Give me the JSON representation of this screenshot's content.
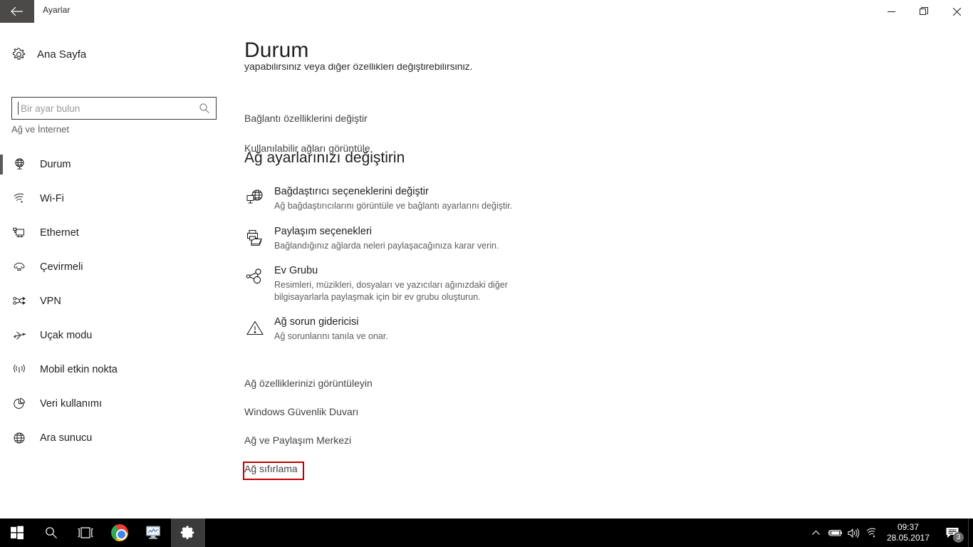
{
  "window": {
    "title": "Ayarlar",
    "back_icon": "back-arrow-icon",
    "minimize_label": "—",
    "restore_label": "❐",
    "close_label": "✕"
  },
  "sidebar": {
    "home": {
      "label": "Ana Sayfa",
      "icon": "gear-icon"
    },
    "search": {
      "value": "",
      "placeholder": "Bir ayar bulun",
      "icon": "search-icon"
    },
    "category": "Ağ ve İnternet",
    "items": [
      {
        "label": "Durum",
        "icon": "globe-status-icon",
        "selected": true
      },
      {
        "label": "Wi-Fi",
        "icon": "wifi-icon",
        "selected": false
      },
      {
        "label": "Ethernet",
        "icon": "ethernet-icon",
        "selected": false
      },
      {
        "label": "Çevirmeli",
        "icon": "dialup-icon",
        "selected": false
      },
      {
        "label": "VPN",
        "icon": "vpn-icon",
        "selected": false
      },
      {
        "label": "Uçak modu",
        "icon": "airplane-icon",
        "selected": false
      },
      {
        "label": "Mobil etkin nokta",
        "icon": "hotspot-icon",
        "selected": false
      },
      {
        "label": "Veri kullanımı",
        "icon": "pie-chart-icon",
        "selected": false
      },
      {
        "label": "Ara sunucu",
        "icon": "proxy-globe-icon",
        "selected": false
      }
    ]
  },
  "content": {
    "page_title": "Durum",
    "clipped_text": "yapabilirsiniz veya diğer özellikleri değiştirebilirsiniz.",
    "top_links": [
      "Bağlantı özelliklerini değiştir",
      "Kullanılabilir ağları görüntüle"
    ],
    "section_header": "Ağ ayarlarınızı değiştirin",
    "actions": [
      {
        "icon": "network-adapter-icon",
        "title": "Bağdaştırıcı seçeneklerini değiştir",
        "desc": "Ağ bağdaştırıcılarını görüntüle ve bağlantı ayarlarını değiştir."
      },
      {
        "icon": "sharing-printer-folder-icon",
        "title": "Paylaşım seçenekleri",
        "desc": "Bağlandığınız ağlarda neleri paylaşacağınıza karar verin."
      },
      {
        "icon": "homegroup-icon",
        "title": "Ev Grubu",
        "desc": "Resimleri, müzikleri, dosyaları ve yazıcıları ağınızdaki diğer bilgisayarlarla paylaşmak için bir ev grubu oluşturun."
      },
      {
        "icon": "warning-triangle-icon",
        "title": "Ağ sorun gidericisi",
        "desc": "Ağ sorunlarını tanıla ve onar."
      }
    ],
    "bottom_links": [
      "Ağ özelliklerinizi görüntüleyin",
      "Windows Güvenlik Duvarı",
      "Ağ ve Paylaşım Merkezi",
      "Ağ sıfırlama"
    ],
    "highlight_color": "#c00000",
    "highlighted_link": "Ağ sıfırlama"
  },
  "taskbar": {
    "buttons": [
      {
        "name": "start",
        "icon": "windows-logo-icon",
        "active": false
      },
      {
        "name": "search",
        "icon": "search-icon",
        "active": false
      },
      {
        "name": "task-view",
        "icon": "task-view-icon",
        "active": false
      },
      {
        "name": "chrome",
        "icon": "chrome-icon",
        "active": false
      },
      {
        "name": "task-manager",
        "icon": "monitor-graph-icon",
        "active": false
      },
      {
        "name": "settings",
        "icon": "gear-icon",
        "active": true
      }
    ],
    "tray": {
      "chevron": "chevron-up-icon",
      "battery": "battery-charging-icon",
      "volume": "speaker-icon",
      "wifi": "wifi-icon",
      "time": "09:37",
      "date": "28.05.2017",
      "notifications_icon": "action-center-icon",
      "notification_count": "3"
    }
  }
}
